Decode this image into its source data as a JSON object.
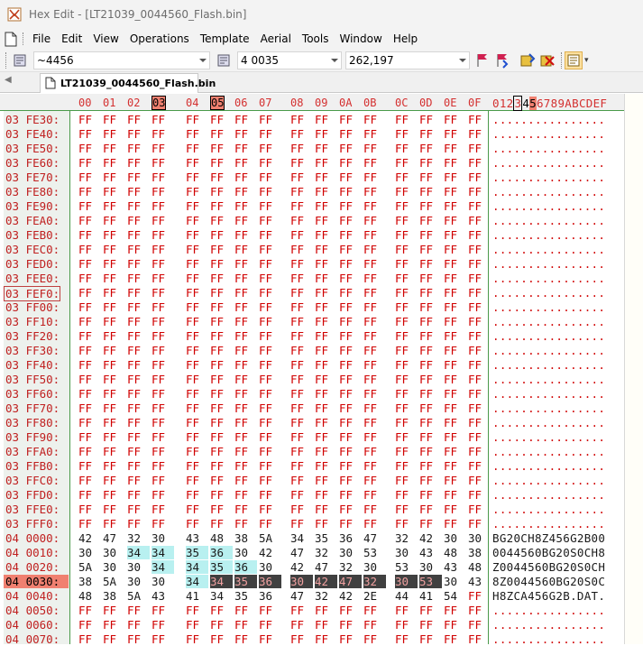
{
  "window": {
    "title": "Hex Edit - [LT21039_0044560_Flash.bin]"
  },
  "menu": {
    "items": [
      "File",
      "Edit",
      "View",
      "Operations",
      "Template",
      "Aerial",
      "Tools",
      "Window",
      "Help"
    ]
  },
  "toolbar": {
    "search_value": "~4456",
    "jump_value": "4 0035",
    "decimal_value": "262,197"
  },
  "tab": {
    "label": "LT21039_0044560_Flash.bin"
  },
  "header": {
    "columns": [
      "00",
      "01",
      "02",
      "03",
      "04",
      "05",
      "06",
      "07",
      "08",
      "09",
      "0A",
      "0B",
      "0C",
      "0D",
      "0E",
      "0F"
    ],
    "ascii_header": "0123456789ABCDEF",
    "highlighted_columns": [
      "03",
      "05"
    ]
  },
  "rows": [
    {
      "addr": "03 FE30:",
      "hex": [
        "FF",
        "FF",
        "FF",
        "FF",
        "FF",
        "FF",
        "FF",
        "FF",
        "FF",
        "FF",
        "FF",
        "FF",
        "FF",
        "FF",
        "FF",
        "FF"
      ],
      "ascii": "................"
    },
    {
      "addr": "03 FE40:",
      "hex": [
        "FF",
        "FF",
        "FF",
        "FF",
        "FF",
        "FF",
        "FF",
        "FF",
        "FF",
        "FF",
        "FF",
        "FF",
        "FF",
        "FF",
        "FF",
        "FF"
      ],
      "ascii": "................"
    },
    {
      "addr": "03 FE50:",
      "hex": [
        "FF",
        "FF",
        "FF",
        "FF",
        "FF",
        "FF",
        "FF",
        "FF",
        "FF",
        "FF",
        "FF",
        "FF",
        "FF",
        "FF",
        "FF",
        "FF"
      ],
      "ascii": "................"
    },
    {
      "addr": "03 FE60:",
      "hex": [
        "FF",
        "FF",
        "FF",
        "FF",
        "FF",
        "FF",
        "FF",
        "FF",
        "FF",
        "FF",
        "FF",
        "FF",
        "FF",
        "FF",
        "FF",
        "FF"
      ],
      "ascii": "................"
    },
    {
      "addr": "03 FE70:",
      "hex": [
        "FF",
        "FF",
        "FF",
        "FF",
        "FF",
        "FF",
        "FF",
        "FF",
        "FF",
        "FF",
        "FF",
        "FF",
        "FF",
        "FF",
        "FF",
        "FF"
      ],
      "ascii": "................"
    },
    {
      "addr": "03 FE80:",
      "hex": [
        "FF",
        "FF",
        "FF",
        "FF",
        "FF",
        "FF",
        "FF",
        "FF",
        "FF",
        "FF",
        "FF",
        "FF",
        "FF",
        "FF",
        "FF",
        "FF"
      ],
      "ascii": "................"
    },
    {
      "addr": "03 FE90:",
      "hex": [
        "FF",
        "FF",
        "FF",
        "FF",
        "FF",
        "FF",
        "FF",
        "FF",
        "FF",
        "FF",
        "FF",
        "FF",
        "FF",
        "FF",
        "FF",
        "FF"
      ],
      "ascii": "................"
    },
    {
      "addr": "03 FEA0:",
      "hex": [
        "FF",
        "FF",
        "FF",
        "FF",
        "FF",
        "FF",
        "FF",
        "FF",
        "FF",
        "FF",
        "FF",
        "FF",
        "FF",
        "FF",
        "FF",
        "FF"
      ],
      "ascii": "................"
    },
    {
      "addr": "03 FEB0:",
      "hex": [
        "FF",
        "FF",
        "FF",
        "FF",
        "FF",
        "FF",
        "FF",
        "FF",
        "FF",
        "FF",
        "FF",
        "FF",
        "FF",
        "FF",
        "FF",
        "FF"
      ],
      "ascii": "................"
    },
    {
      "addr": "03 FEC0:",
      "hex": [
        "FF",
        "FF",
        "FF",
        "FF",
        "FF",
        "FF",
        "FF",
        "FF",
        "FF",
        "FF",
        "FF",
        "FF",
        "FF",
        "FF",
        "FF",
        "FF"
      ],
      "ascii": "................"
    },
    {
      "addr": "03 FED0:",
      "hex": [
        "FF",
        "FF",
        "FF",
        "FF",
        "FF",
        "FF",
        "FF",
        "FF",
        "FF",
        "FF",
        "FF",
        "FF",
        "FF",
        "FF",
        "FF",
        "FF"
      ],
      "ascii": "................"
    },
    {
      "addr": "03 FEE0:",
      "hex": [
        "FF",
        "FF",
        "FF",
        "FF",
        "FF",
        "FF",
        "FF",
        "FF",
        "FF",
        "FF",
        "FF",
        "FF",
        "FF",
        "FF",
        "FF",
        "FF"
      ],
      "ascii": "................"
    },
    {
      "addr": "03 FEF0:",
      "hex": [
        "FF",
        "FF",
        "FF",
        "FF",
        "FF",
        "FF",
        "FF",
        "FF",
        "FF",
        "FF",
        "FF",
        "FF",
        "FF",
        "FF",
        "FF",
        "FF"
      ],
      "ascii": "................",
      "addr_box": true
    },
    {
      "addr": "03 FF00:",
      "hex": [
        "FF",
        "FF",
        "FF",
        "FF",
        "FF",
        "FF",
        "FF",
        "FF",
        "FF",
        "FF",
        "FF",
        "FF",
        "FF",
        "FF",
        "FF",
        "FF"
      ],
      "ascii": "................"
    },
    {
      "addr": "03 FF10:",
      "hex": [
        "FF",
        "FF",
        "FF",
        "FF",
        "FF",
        "FF",
        "FF",
        "FF",
        "FF",
        "FF",
        "FF",
        "FF",
        "FF",
        "FF",
        "FF",
        "FF"
      ],
      "ascii": "................"
    },
    {
      "addr": "03 FF20:",
      "hex": [
        "FF",
        "FF",
        "FF",
        "FF",
        "FF",
        "FF",
        "FF",
        "FF",
        "FF",
        "FF",
        "FF",
        "FF",
        "FF",
        "FF",
        "FF",
        "FF"
      ],
      "ascii": "................"
    },
    {
      "addr": "03 FF30:",
      "hex": [
        "FF",
        "FF",
        "FF",
        "FF",
        "FF",
        "FF",
        "FF",
        "FF",
        "FF",
        "FF",
        "FF",
        "FF",
        "FF",
        "FF",
        "FF",
        "FF"
      ],
      "ascii": "................"
    },
    {
      "addr": "03 FF40:",
      "hex": [
        "FF",
        "FF",
        "FF",
        "FF",
        "FF",
        "FF",
        "FF",
        "FF",
        "FF",
        "FF",
        "FF",
        "FF",
        "FF",
        "FF",
        "FF",
        "FF"
      ],
      "ascii": "................"
    },
    {
      "addr": "03 FF50:",
      "hex": [
        "FF",
        "FF",
        "FF",
        "FF",
        "FF",
        "FF",
        "FF",
        "FF",
        "FF",
        "FF",
        "FF",
        "FF",
        "FF",
        "FF",
        "FF",
        "FF"
      ],
      "ascii": "................"
    },
    {
      "addr": "03 FF60:",
      "hex": [
        "FF",
        "FF",
        "FF",
        "FF",
        "FF",
        "FF",
        "FF",
        "FF",
        "FF",
        "FF",
        "FF",
        "FF",
        "FF",
        "FF",
        "FF",
        "FF"
      ],
      "ascii": "................"
    },
    {
      "addr": "03 FF70:",
      "hex": [
        "FF",
        "FF",
        "FF",
        "FF",
        "FF",
        "FF",
        "FF",
        "FF",
        "FF",
        "FF",
        "FF",
        "FF",
        "FF",
        "FF",
        "FF",
        "FF"
      ],
      "ascii": "................"
    },
    {
      "addr": "03 FF80:",
      "hex": [
        "FF",
        "FF",
        "FF",
        "FF",
        "FF",
        "FF",
        "FF",
        "FF",
        "FF",
        "FF",
        "FF",
        "FF",
        "FF",
        "FF",
        "FF",
        "FF"
      ],
      "ascii": "................"
    },
    {
      "addr": "03 FF90:",
      "hex": [
        "FF",
        "FF",
        "FF",
        "FF",
        "FF",
        "FF",
        "FF",
        "FF",
        "FF",
        "FF",
        "FF",
        "FF",
        "FF",
        "FF",
        "FF",
        "FF"
      ],
      "ascii": "................"
    },
    {
      "addr": "03 FFA0:",
      "hex": [
        "FF",
        "FF",
        "FF",
        "FF",
        "FF",
        "FF",
        "FF",
        "FF",
        "FF",
        "FF",
        "FF",
        "FF",
        "FF",
        "FF",
        "FF",
        "FF"
      ],
      "ascii": "................"
    },
    {
      "addr": "03 FFB0:",
      "hex": [
        "FF",
        "FF",
        "FF",
        "FF",
        "FF",
        "FF",
        "FF",
        "FF",
        "FF",
        "FF",
        "FF",
        "FF",
        "FF",
        "FF",
        "FF",
        "FF"
      ],
      "ascii": "................"
    },
    {
      "addr": "03 FFC0:",
      "hex": [
        "FF",
        "FF",
        "FF",
        "FF",
        "FF",
        "FF",
        "FF",
        "FF",
        "FF",
        "FF",
        "FF",
        "FF",
        "FF",
        "FF",
        "FF",
        "FF"
      ],
      "ascii": "................"
    },
    {
      "addr": "03 FFD0:",
      "hex": [
        "FF",
        "FF",
        "FF",
        "FF",
        "FF",
        "FF",
        "FF",
        "FF",
        "FF",
        "FF",
        "FF",
        "FF",
        "FF",
        "FF",
        "FF",
        "FF"
      ],
      "ascii": "................"
    },
    {
      "addr": "03 FFE0:",
      "hex": [
        "FF",
        "FF",
        "FF",
        "FF",
        "FF",
        "FF",
        "FF",
        "FF",
        "FF",
        "FF",
        "FF",
        "FF",
        "FF",
        "FF",
        "FF",
        "FF"
      ],
      "ascii": "................"
    },
    {
      "addr": "03 FFF0:",
      "hex": [
        "FF",
        "FF",
        "FF",
        "FF",
        "FF",
        "FF",
        "FF",
        "FF",
        "FF",
        "FF",
        "FF",
        "FF",
        "FF",
        "FF",
        "FF",
        "FF"
      ],
      "ascii": "................"
    },
    {
      "addr": "04 0000:",
      "hex": [
        "42",
        "47",
        "32",
        "30",
        "43",
        "48",
        "38",
        "5A",
        "34",
        "35",
        "36",
        "47",
        "32",
        "42",
        "30",
        "30"
      ],
      "ascii": "BG20CH8Z456G2B00",
      "data": true
    },
    {
      "addr": "04 0010:",
      "hex": [
        "30",
        "30",
        "34",
        "34",
        "35",
        "36",
        "30",
        "42",
        "47",
        "32",
        "30",
        "53",
        "30",
        "43",
        "48",
        "38"
      ],
      "ascii": "0044560BG20S0CH8",
      "data": true,
      "hl": [
        2,
        3,
        4,
        5
      ]
    },
    {
      "addr": "04 0020:",
      "hex": [
        "5A",
        "30",
        "30",
        "34",
        "34",
        "35",
        "36",
        "30",
        "42",
        "47",
        "32",
        "30",
        "53",
        "30",
        "43",
        "48"
      ],
      "ascii": "Z0044560BG20S0CH",
      "data": true,
      "hl": [
        3,
        4,
        5,
        6
      ]
    },
    {
      "addr": "04 0030:",
      "hex": [
        "38",
        "5A",
        "30",
        "30",
        "34",
        "34",
        "35",
        "36",
        "30",
        "42",
        "47",
        "32",
        "30",
        "53",
        "30",
        "43"
      ],
      "ascii": "8Z0044560BG20S0C",
      "data": true,
      "cur": true,
      "hl": [
        4
      ],
      "mk": [
        5,
        6,
        7,
        8,
        9,
        10,
        11,
        12,
        13
      ]
    },
    {
      "addr": "04 0040:",
      "hex": [
        "48",
        "38",
        "5A",
        "43",
        "41",
        "34",
        "35",
        "36",
        "47",
        "32",
        "42",
        "2E",
        "44",
        "41",
        "54",
        "FF"
      ],
      "ascii": "H8ZCA456G2B.DAT.",
      "data": true
    },
    {
      "addr": "04 0050:",
      "hex": [
        "FF",
        "FF",
        "FF",
        "FF",
        "FF",
        "FF",
        "FF",
        "FF",
        "FF",
        "FF",
        "FF",
        "FF",
        "FF",
        "FF",
        "FF",
        "FF"
      ],
      "ascii": "................"
    },
    {
      "addr": "04 0060:",
      "hex": [
        "FF",
        "FF",
        "FF",
        "FF",
        "FF",
        "FF",
        "FF",
        "FF",
        "FF",
        "FF",
        "FF",
        "FF",
        "FF",
        "FF",
        "FF",
        "FF"
      ],
      "ascii": "................"
    },
    {
      "addr": "04 0070:",
      "hex": [
        "FF",
        "FF",
        "FF",
        "FF",
        "FF",
        "FF",
        "FF",
        "FF",
        "FF",
        "FF",
        "FF",
        "FF",
        "FF",
        "FF",
        "FF",
        "FF"
      ],
      "ascii": "................"
    }
  ]
}
